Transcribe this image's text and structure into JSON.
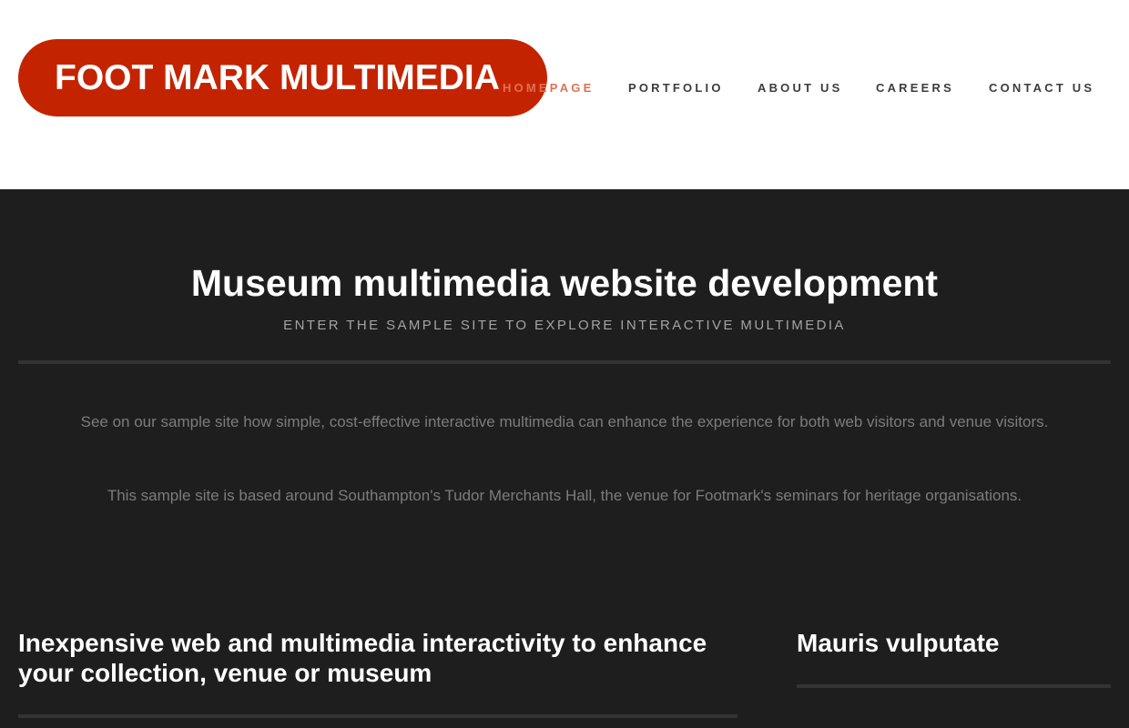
{
  "header": {
    "logo_text": "FOOT MARK MULTIMEDIA",
    "nav": [
      {
        "label": "HOMEPAGE",
        "active": true
      },
      {
        "label": "PORTFOLIO"
      },
      {
        "label": "ABOUT US"
      },
      {
        "label": "CAREERS"
      },
      {
        "label": "CONTACT US"
      }
    ]
  },
  "hero": {
    "title": "Museum multimedia website development",
    "subtitle": "ENTER THE SAMPLE SITE TO EXPLORE INTERACTIVE MULTIMEDIA"
  },
  "intro": {
    "paragraph_1": "See on our sample site how simple, cost-effective interactive multimedia can enhance the experience for both web visitors and venue visitors.",
    "paragraph_2": "This sample site is based around Southampton's Tudor Merchants Hall, the venue for Footmark's seminars for heritage organisations."
  },
  "columns": {
    "left_title": "Inexpensive web and multimedia interactivity to enhance your collection, venue or museum",
    "right_title": "Mauris vulputate"
  },
  "colors": {
    "brand_red": "#c42300",
    "nav_active": "#e07056",
    "dark_bg": "#1e1e1e"
  }
}
